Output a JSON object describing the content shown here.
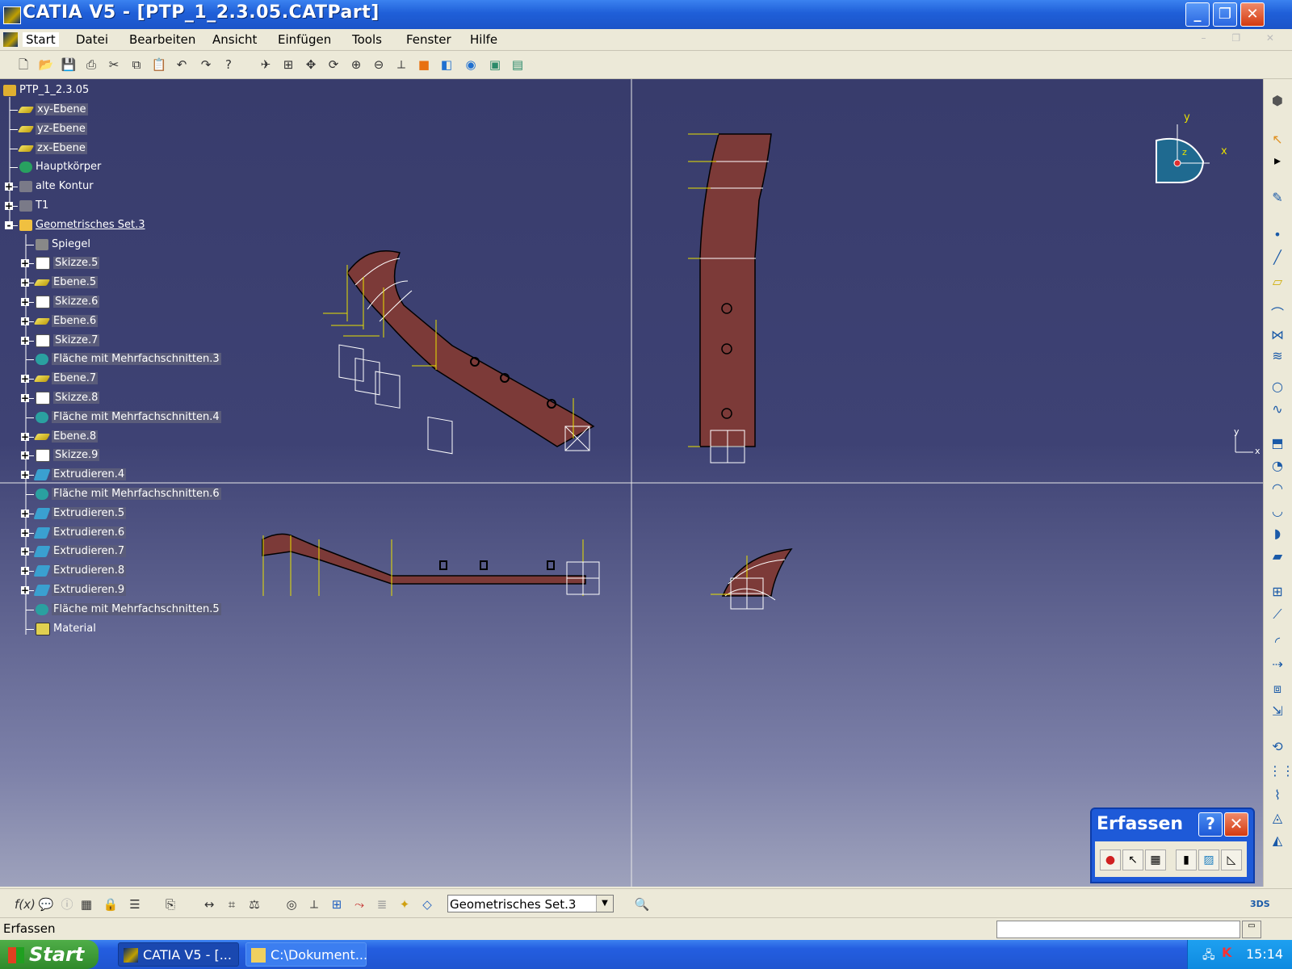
{
  "window": {
    "title": "CATIA V5 - [PTP_1_2.3.05.CATPart]",
    "buttons": {
      "minimize": "_",
      "maximize": "❐",
      "close": "✕"
    }
  },
  "menu": [
    "Start",
    "Datei",
    "Bearbeiten",
    "Ansicht",
    "Einfügen",
    "Tools",
    "Fenster",
    "Hilfe"
  ],
  "toolbar_icons": [
    "new-icon",
    "open-icon",
    "save-icon",
    "print-icon",
    "cut-icon",
    "copy-icon",
    "paste-icon",
    "undo-icon",
    "redo-icon",
    "whats-this-icon",
    "fly-mode-icon",
    "fit-all-icon",
    "pan-icon",
    "rotate-icon",
    "zoom-in-icon",
    "zoom-out-icon",
    "normal-view-icon",
    "multi-view-icon",
    "iso-view-icon",
    "shading-icon",
    "hide-show-icon",
    "swap-visible-icon"
  ],
  "tree": {
    "root": "PTP_1_2.3.05",
    "items": [
      {
        "label": "xy-Ebene",
        "level": 1,
        "icon": "plane-icon",
        "expander": ""
      },
      {
        "label": "yz-Ebene",
        "level": 1,
        "icon": "plane-icon",
        "expander": ""
      },
      {
        "label": "zx-Ebene",
        "level": 1,
        "icon": "plane-icon",
        "expander": ""
      },
      {
        "label": "Hauptkörper",
        "level": 1,
        "icon": "body-icon",
        "expander": ""
      },
      {
        "label": "alte Kontur",
        "level": 1,
        "icon": "hidden-set-icon",
        "expander": "+"
      },
      {
        "label": "T1",
        "level": 1,
        "icon": "hidden-set-icon",
        "expander": "+"
      },
      {
        "label": "Geometrisches Set.3",
        "level": 1,
        "icon": "geometrical-set-icon",
        "expander": "-"
      },
      {
        "label": "Spiegel",
        "level": 2,
        "icon": "mirror-icon",
        "expander": ""
      },
      {
        "label": "Skizze.5",
        "level": 2,
        "icon": "sketch-icon",
        "expander": "+"
      },
      {
        "label": "Ebene.5",
        "level": 2,
        "icon": "plane-icon",
        "expander": "+"
      },
      {
        "label": "Skizze.6",
        "level": 2,
        "icon": "sketch-icon",
        "expander": "+"
      },
      {
        "label": "Ebene.6",
        "level": 2,
        "icon": "plane-icon",
        "expander": "+"
      },
      {
        "label": "Skizze.7",
        "level": 2,
        "icon": "sketch-icon",
        "expander": "+"
      },
      {
        "label": "Fläche mit Mehrfachschnitten.3",
        "level": 2,
        "icon": "multisection-surface-icon",
        "expander": ""
      },
      {
        "label": "Ebene.7",
        "level": 2,
        "icon": "plane-icon",
        "expander": "+"
      },
      {
        "label": "Skizze.8",
        "level": 2,
        "icon": "sketch-icon",
        "expander": "+"
      },
      {
        "label": "Fläche mit Mehrfachschnitten.4",
        "level": 2,
        "icon": "multisection-surface-icon",
        "expander": ""
      },
      {
        "label": "Ebene.8",
        "level": 2,
        "icon": "plane-icon",
        "expander": "+"
      },
      {
        "label": "Skizze.9",
        "level": 2,
        "icon": "sketch-icon",
        "expander": "+"
      },
      {
        "label": "Extrudieren.4",
        "level": 2,
        "icon": "extrude-icon",
        "expander": "+"
      },
      {
        "label": "Fläche mit Mehrfachschnitten.6",
        "level": 2,
        "icon": "multisection-surface-icon",
        "expander": ""
      },
      {
        "label": "Extrudieren.5",
        "level": 2,
        "icon": "extrude-icon",
        "expander": "+"
      },
      {
        "label": "Extrudieren.6",
        "level": 2,
        "icon": "extrude-icon",
        "expander": "+"
      },
      {
        "label": "Extrudieren.7",
        "level": 2,
        "icon": "extrude-icon",
        "expander": "+"
      },
      {
        "label": "Extrudieren.8",
        "level": 2,
        "icon": "extrude-icon",
        "expander": "+"
      },
      {
        "label": "Extrudieren.9",
        "level": 2,
        "icon": "extrude-icon",
        "expander": "+"
      },
      {
        "label": "Fläche mit Mehrfachschnitten.5",
        "level": 2,
        "icon": "multisection-surface-icon",
        "expander": ""
      },
      {
        "label": "Material",
        "level": 2,
        "icon": "material-icon",
        "expander": ""
      }
    ]
  },
  "compass": {
    "x_label": "x",
    "y_label": "y",
    "z_label": "z"
  },
  "axis_indicator": {
    "x_label": "x",
    "y_label": "y"
  },
  "erfassen": {
    "title": "Erfassen",
    "help": "?",
    "close": "✕"
  },
  "set_select": {
    "value": "Geometrisches Set.3"
  },
  "status": {
    "message": "Erfassen"
  },
  "taskbar": {
    "start": "Start",
    "tasks": [
      "CATIA V5 - [...",
      "C:\\Dokument..."
    ],
    "clock": "15:14"
  },
  "colors": {
    "part": "#7c3a38",
    "viewport_top": "#383c6c",
    "viewport_bottom": "#9ea2bc",
    "titlebar": "#1f5fd8",
    "construction": "#e8e000"
  }
}
